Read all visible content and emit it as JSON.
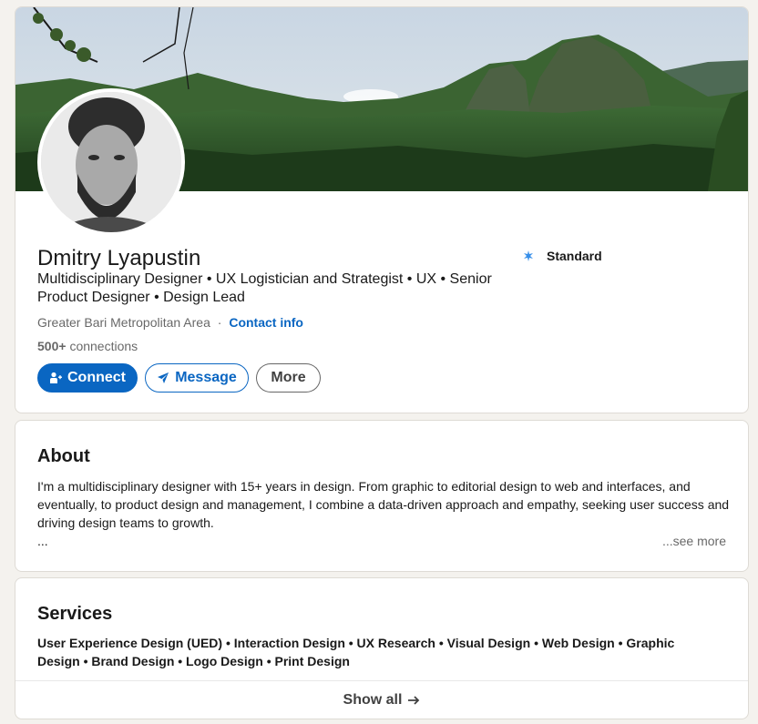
{
  "profile": {
    "name": "Dmitry Lyapustin",
    "headline": "Multidisciplinary Designer • UX Logistician and Strategist • UX • Senior Product Designer • Design Lead",
    "location": "Greater Bari Metropolitan Area",
    "separator": "·",
    "contact_info_label": "Contact info",
    "connections_count": "500+",
    "connections_label": "connections",
    "badge_label": "Standard",
    "badge_icon": "sparkle-icon"
  },
  "actions": {
    "connect_label": "Connect",
    "connect_icon": "add-person-icon",
    "message_label": "Message",
    "message_icon": "send-icon",
    "more_label": "More"
  },
  "about": {
    "title": "About",
    "text": "I'm a multidisciplinary designer with 15+ years in design. From graphic to editorial design to web and interfaces, and eventually, to product design and management, I combine a data-driven approach and empathy, seeking user success and driving design teams to growth.",
    "ellipsis": "...",
    "see_more_label": "...see more"
  },
  "services": {
    "title": "Services",
    "list": "User Experience Design (UED) • Interaction Design • UX Research • Visual Design • Web Design • Graphic Design • Brand Design • Logo Design • Print Design",
    "show_all_label": "Show all",
    "show_all_icon": "arrow-right-icon"
  },
  "colors": {
    "page_bg": "#f4f2ee",
    "accent": "#0a66c2",
    "card_bg": "#ffffff",
    "badge_star": "#378fe9"
  }
}
